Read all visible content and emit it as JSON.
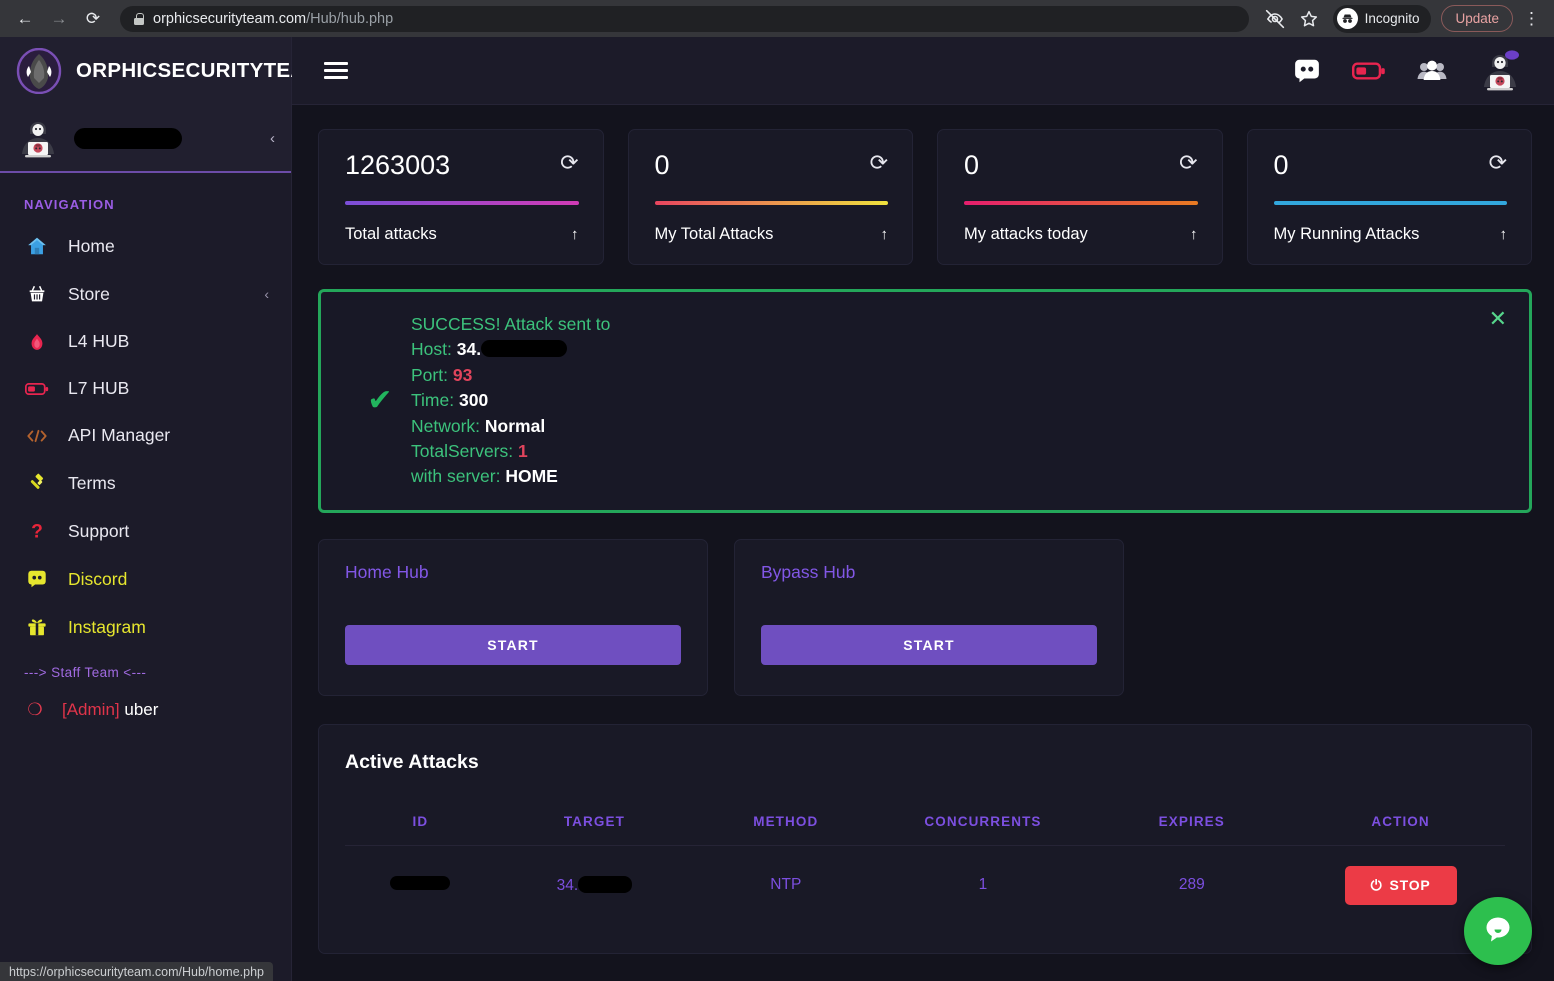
{
  "browser": {
    "back_icon": "back-arrow-icon",
    "forward_icon": "forward-arrow-icon",
    "reload_icon": "reload-icon",
    "url_domain": "orphicsecurityteam.com",
    "url_path": "/Hub/hub.php",
    "hide_icon": "eye-slash-icon",
    "bookmark_icon": "star-icon",
    "incognito_label": "Incognito",
    "update_label": "Update",
    "menu_icon": "kebab-menu-icon",
    "status_url": "https://orphicsecurityteam.com/Hub/home.php"
  },
  "sidebar": {
    "brand_title": "ORPHICSECURITYTEAM",
    "user_name": "",
    "nav_heading": "NAVIGATION",
    "items": [
      {
        "label": "Home",
        "icon": "house-icon",
        "has_arrow": false
      },
      {
        "label": "Store",
        "icon": "basket-icon",
        "has_arrow": true
      },
      {
        "label": "L4 HUB",
        "icon": "fire-icon",
        "has_arrow": false
      },
      {
        "label": "L7 HUB",
        "icon": "battery-icon",
        "has_arrow": false
      },
      {
        "label": "API Manager",
        "icon": "code-tags-icon",
        "has_arrow": false
      },
      {
        "label": "Terms",
        "icon": "gavel-icon",
        "has_arrow": false
      },
      {
        "label": "Support",
        "icon": "question-icon",
        "has_arrow": false
      },
      {
        "label": "Discord",
        "icon": "discord-icon",
        "has_arrow": false
      },
      {
        "label": "Instagram",
        "icon": "gift-icon",
        "has_arrow": false
      }
    ],
    "staff_divider": "---> Staff Team <---",
    "staff": {
      "tag": "[Admin]",
      "name": " uber"
    },
    "collapse_icon": "chevron-left-icon"
  },
  "topbar": {
    "menu_icon": "hamburger-icon",
    "icons": [
      "discord-icon",
      "battery-icon",
      "users-group-icon",
      "hacker-avatar-icon"
    ]
  },
  "stats": [
    {
      "value": "1263003",
      "label": "Total attacks",
      "bar_from": "#7b4fd8",
      "bar_to": "#d13bb5"
    },
    {
      "value": "0",
      "label": "My Total Attacks",
      "bar_from": "#e8455f",
      "bar_to": "#efe23d"
    },
    {
      "value": "0",
      "label": "My attacks today",
      "bar_from": "#e61e6e",
      "bar_to": "#e87b22"
    },
    {
      "value": "0",
      "label": "My Running Attacks",
      "bar_from": "#32a7dd",
      "bar_to": "#32a7dd"
    }
  ],
  "alert": {
    "check_icon": "check-icon",
    "close_icon": "close-icon",
    "title": "SUCCESS! Attack sent to",
    "rows": [
      {
        "label": "Host:",
        "value": "34.",
        "value_style": "white",
        "redacted": true
      },
      {
        "label": "Port:",
        "value": "93",
        "value_style": "red",
        "redacted": false
      },
      {
        "label": "Time:",
        "value": "300",
        "value_style": "white",
        "redacted": false
      },
      {
        "label": "Network:",
        "value": "Normal",
        "value_style": "white",
        "redacted": false
      },
      {
        "label": "TotalServers:",
        "value": "1",
        "value_style": "red",
        "redacted": false
      },
      {
        "label": "with server:",
        "value": "HOME",
        "value_style": "white",
        "redacted": false
      }
    ]
  },
  "hubs": [
    {
      "title": "Home Hub",
      "button": "START"
    },
    {
      "title": "Bypass Hub",
      "button": "START"
    }
  ],
  "attacks": {
    "title": "Active Attacks",
    "columns": [
      "ID",
      "TARGET",
      "METHOD",
      "CONCURRENTS",
      "EXPIRES",
      "ACTION"
    ],
    "rows": [
      {
        "id": "",
        "target": "34.",
        "method": "NTP",
        "concurrents": "1",
        "expires": "289",
        "action_label": "STOP",
        "action_icon": "power-icon"
      }
    ]
  },
  "chat": {
    "icon": "chat-bubble-icon",
    "color": "#2dbf4e"
  }
}
